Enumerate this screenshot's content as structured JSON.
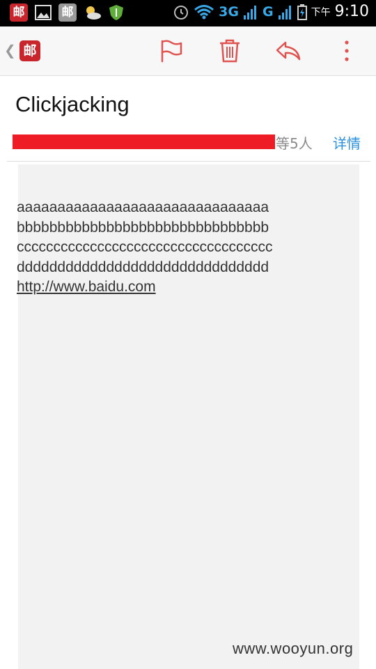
{
  "status_bar": {
    "app_icon_label": "邮",
    "network_3g": "3G",
    "network_g": "G",
    "ampm": "下午",
    "time": "9:10"
  },
  "toolbar": {
    "logo_label": "邮",
    "accent_color": "#e0524f",
    "icons": [
      "flag-icon",
      "trash-icon",
      "reply-icon",
      "overflow-menu-icon"
    ]
  },
  "email": {
    "subject": "Clickjacking",
    "recipients_more": "等5人",
    "details_link": "详情",
    "body_lines": [
      "aaaaaaaaaaaaaaaaaaaaaaaaaaaaaaa",
      "bbbbbbbbbbbbbbbbbbbbbbbbbbbbbbb",
      "ccccccccccccccccccccccccccccccccccc",
      "ddddddddddddddddddddddddddddddd"
    ],
    "body_link": "http://www.baidu.com"
  },
  "watermark": "www.wooyun.org"
}
